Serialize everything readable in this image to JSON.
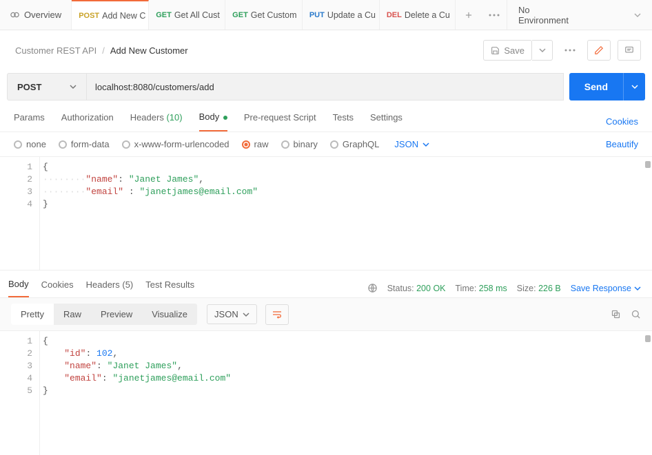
{
  "topbar": {
    "overview": "Overview",
    "tabs": [
      {
        "method": "POST",
        "mclass": "m-post",
        "label": "Add New C"
      },
      {
        "method": "GET",
        "mclass": "m-get",
        "label": "Get All Cust"
      },
      {
        "method": "GET",
        "mclass": "m-get",
        "label": "Get Custom"
      },
      {
        "method": "PUT",
        "mclass": "m-put",
        "label": "Update a Cu"
      },
      {
        "method": "DEL",
        "mclass": "m-del",
        "label": "Delete a Cu"
      }
    ],
    "environment": "No Environment"
  },
  "crumb": {
    "collection": "Customer REST API",
    "current": "Add New Customer",
    "save": "Save"
  },
  "request": {
    "method": "POST",
    "url": "localhost:8080/customers/add",
    "send": "Send"
  },
  "cfg": {
    "params": "Params",
    "auth": "Authorization",
    "headers_label": "Headers",
    "headers_count": "(10)",
    "body": "Body",
    "prereq": "Pre-request Script",
    "tests": "Tests",
    "settings": "Settings",
    "cookies": "Cookies"
  },
  "bodytypes": {
    "none": "none",
    "formdata": "form-data",
    "xurl": "x-www-form-urlencoded",
    "raw": "raw",
    "binary": "binary",
    "graphql": "GraphQL",
    "json": "JSON",
    "beautify": "Beautify"
  },
  "reqbody": {
    "l1": "{",
    "l2_key": "\"name\"",
    "l2_val": "\"Janet James\"",
    "l3_key": "\"email\"",
    "l3_val": "\"janetjames@email.com\"",
    "l4": "}"
  },
  "resp": {
    "body": "Body",
    "cookies": "Cookies",
    "headers_label": "Headers",
    "headers_count": "(5)",
    "tests": "Test Results",
    "status_label": "Status:",
    "status_val": "200 OK",
    "time_label": "Time:",
    "time_val": "258 ms",
    "size_label": "Size:",
    "size_val": "226 B",
    "save": "Save Response"
  },
  "respopts": {
    "pretty": "Pretty",
    "raw": "Raw",
    "preview": "Preview",
    "visualize": "Visualize",
    "json": "JSON"
  },
  "respbody": {
    "l1": "{",
    "l2_key": "\"id\"",
    "l2_val": "102",
    "l3_key": "\"name\"",
    "l3_val": "\"Janet James\"",
    "l4_key": "\"email\"",
    "l4_val": "\"janetjames@email.com\"",
    "l5": "}"
  }
}
